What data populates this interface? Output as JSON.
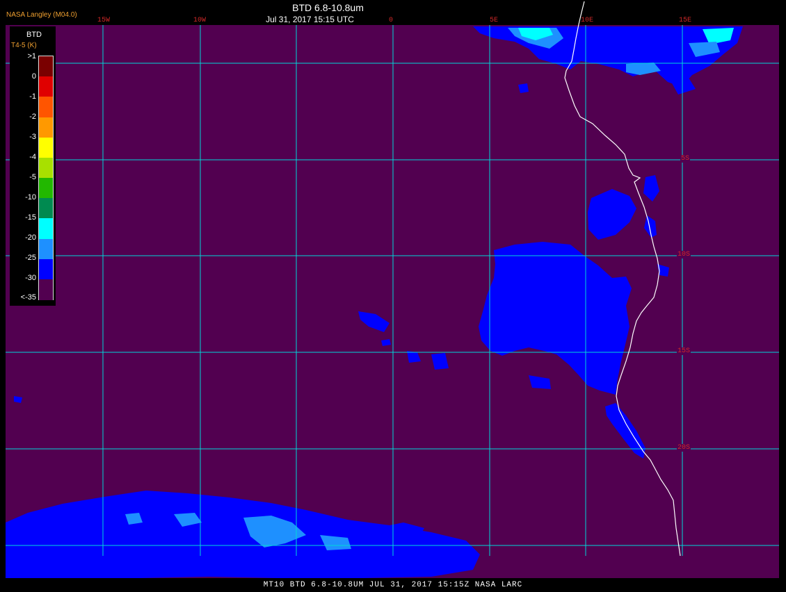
{
  "header": {
    "agency": "NASA Langley (M04.0)",
    "title": "BTD 6.8-10.8um",
    "timestamp": "Jul 31, 2017 15:15 UTC"
  },
  "longitude_labels": [
    "15W",
    "10W",
    "0",
    "5E",
    "10E",
    "15E"
  ],
  "latitude_labels": [
    "5S",
    "10S",
    "15S",
    "20S"
  ],
  "legend": {
    "title": "BTD",
    "subtitle": "T4-5 (K)",
    "labels": [
      ">1",
      "0",
      "-1",
      "-2",
      "-3",
      "-4",
      "-5",
      "-10",
      "-15",
      "-20",
      "-25",
      "-30",
      "<-35"
    ],
    "colors": [
      "#7a0000",
      "#e00000",
      "#ff5500",
      "#ff9900",
      "#ffff00",
      "#a8e000",
      "#22b800",
      "#008a50",
      "#00ffff",
      "#1e90ff",
      "#0000ff",
      "#520050"
    ]
  },
  "colors": {
    "background": "#520050",
    "grid": "#00d8d8",
    "coastline": "#ffffff",
    "cloud_blue": "#0000ff",
    "cloud_light": "#1e90ff",
    "cloud_cyan": "#00ffff"
  },
  "footer": {
    "caption": "MT10  BTD 6.8-10.8UM   JUL 31, 2017 15:15Z   NASA LARC"
  }
}
